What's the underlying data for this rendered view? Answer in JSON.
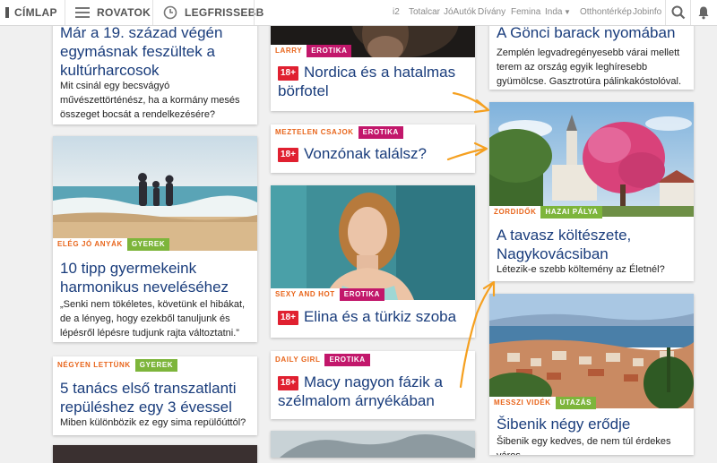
{
  "topbar": {
    "home_label": "CÍMLAP",
    "sections_label": "ROVATOK",
    "latest_label": "LEGFRISSEBB",
    "external_links": [
      "i2",
      "Totalcar",
      "JóAutók",
      "Dívány",
      "Femina",
      "Inda",
      "Otthontérkép",
      "Jobinfo"
    ],
    "search_icon": "search-icon",
    "bell_icon": "bell-icon"
  },
  "colors": {
    "title": "#1a3d7c",
    "orange": "#e8651b",
    "green": "#7db53b",
    "magenta": "#c2176b",
    "red_badge": "#e02030",
    "annotation": "#f5a020"
  },
  "col1": {
    "c1": {
      "title": "Már a 19. század végén egymásnak feszültek a kultúrharcosok",
      "lead": "Mit csinál egy becsvágyó művészettörténész, ha a kormány mesés összeget bocsát a rendelkezésére?"
    },
    "c2": {
      "tag1": "ELÉG JÓ ANYÁK",
      "tag2": "GYEREK",
      "title": "10 tipp gyermekeink harmonikus neveléséhez",
      "lead": "„Senki nem tökéletes, követünk el hibákat, de a lényeg, hogy ezekből tanuljunk és lépésről lépésre tudjunk rajta változtatni.”"
    },
    "c3": {
      "tag1": "NÉGYEN LETTÜNK",
      "tag2": "GYEREK",
      "title": "5 tanács első transzatlanti repüléshez egy 3 évessel",
      "lead": "Miben különbözik ez egy sima repülőúttól?"
    }
  },
  "col2": {
    "c1": {
      "tag1": "LARRY",
      "tag2": "EROTIKA",
      "badge": "18+",
      "title": "Nordica és a hatalmas börfotel"
    },
    "c2": {
      "tag1": "MEZTELEN CSAJOK",
      "tag2": "EROTIKA",
      "badge": "18+",
      "title": "Vonzónak találsz?"
    },
    "c3": {
      "tag1": "SEXY AND HOT",
      "tag2": "EROTIKA",
      "badge": "18+",
      "title": "Elina és a türkiz szoba"
    },
    "c4": {
      "tag1": "DAILY GIRL",
      "tag2": "EROTIKA",
      "badge": "18+",
      "title": "Macy nagyon fázik a szélmalom árnyékában"
    }
  },
  "col3": {
    "c1": {
      "title": "A Gönci barack nyomában",
      "lead": "Zemplén legvadregényesebb várai mellett terem az ország egyik leghíresebb gyümölcse. Gasztrotúra pálinkakóstolóval."
    },
    "c2": {
      "tag1": "ZORDIDŐK",
      "tag2": "HAZAI PÁLYA",
      "title": "A tavasz költészete, Nagykovácsiban",
      "lead": "Létezik-e szebb költemény az Életnél?"
    },
    "c3": {
      "tag1": "MESSZI VIDÉK",
      "tag2": "UTAZÁS",
      "title": "Šibenik négy erődje",
      "lead": "Šibenik egy kedves, de nem túl érdekes város"
    }
  }
}
